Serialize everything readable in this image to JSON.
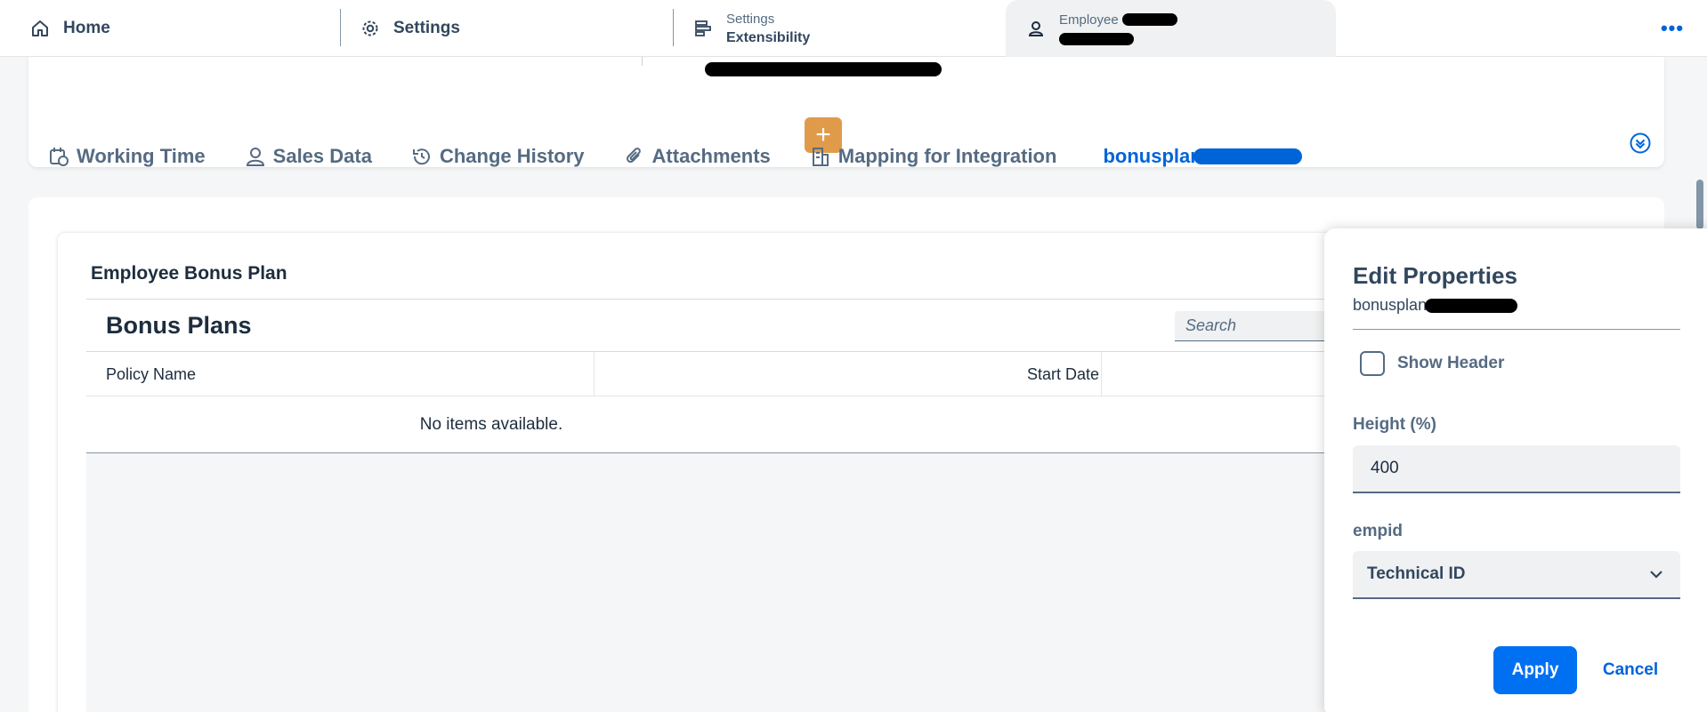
{
  "top_tabs": {
    "home": {
      "label": "Home",
      "icon": "home-icon"
    },
    "settings": {
      "label": "Settings",
      "icon": "gear-icon"
    },
    "extensibility": {
      "small": "Settings",
      "label": "Extensibility",
      "icon": "structure-icon"
    },
    "employee": {
      "small": "Employee",
      "icon": "employee-icon"
    },
    "more": "•••"
  },
  "header": {
    "plus": "+",
    "tabs": [
      {
        "label": "Working Time",
        "icon": "calendar-clock-icon"
      },
      {
        "label": "Sales Data",
        "icon": "people-icon"
      },
      {
        "label": "Change History",
        "icon": "history-icon"
      },
      {
        "label": "Attachments",
        "icon": "paperclip-icon"
      },
      {
        "label": "Mapping for Integration",
        "icon": "building-icon"
      },
      {
        "label": "bonusplan",
        "icon": ""
      }
    ]
  },
  "panel": {
    "title": "Employee Bonus Plan",
    "table_title": "Bonus Plans",
    "search_placeholder": "Search",
    "columns": [
      "Policy Name",
      "Start Date"
    ],
    "empty_text": "No items available."
  },
  "popover": {
    "title": "Edit Properties",
    "subtitle": "bonusplan",
    "show_header_label": "Show Header",
    "height_label": "Height (%)",
    "height_value": "400",
    "empid_label": "empid",
    "empid_value": "Technical ID",
    "apply": "Apply",
    "cancel": "Cancel"
  },
  "colors": {
    "accent": "#0064d9",
    "button": "#0070f2",
    "plus": "#e09b4a",
    "text": "#32475e"
  }
}
